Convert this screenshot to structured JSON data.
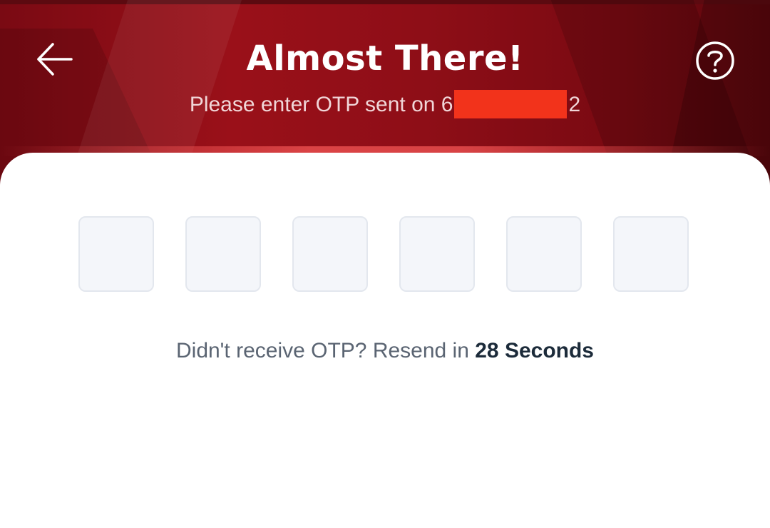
{
  "header": {
    "title": "Almost There!",
    "subtitle_prefix": "Please enter OTP sent on 6",
    "subtitle_suffix": "2",
    "back_icon": "arrow-left-icon",
    "help_icon": "question-circle-icon"
  },
  "otp": {
    "length": 6,
    "values": [
      "",
      "",
      "",
      "",
      "",
      ""
    ]
  },
  "resend": {
    "text": "Didn't receive OTP? Resend in",
    "timer": "28 Seconds"
  },
  "colors": {
    "header_bg": "#8e0e17",
    "redaction": "#f2331b",
    "otp_box_bg": "#f4f6fa",
    "otp_box_border": "#e3e7ee"
  }
}
